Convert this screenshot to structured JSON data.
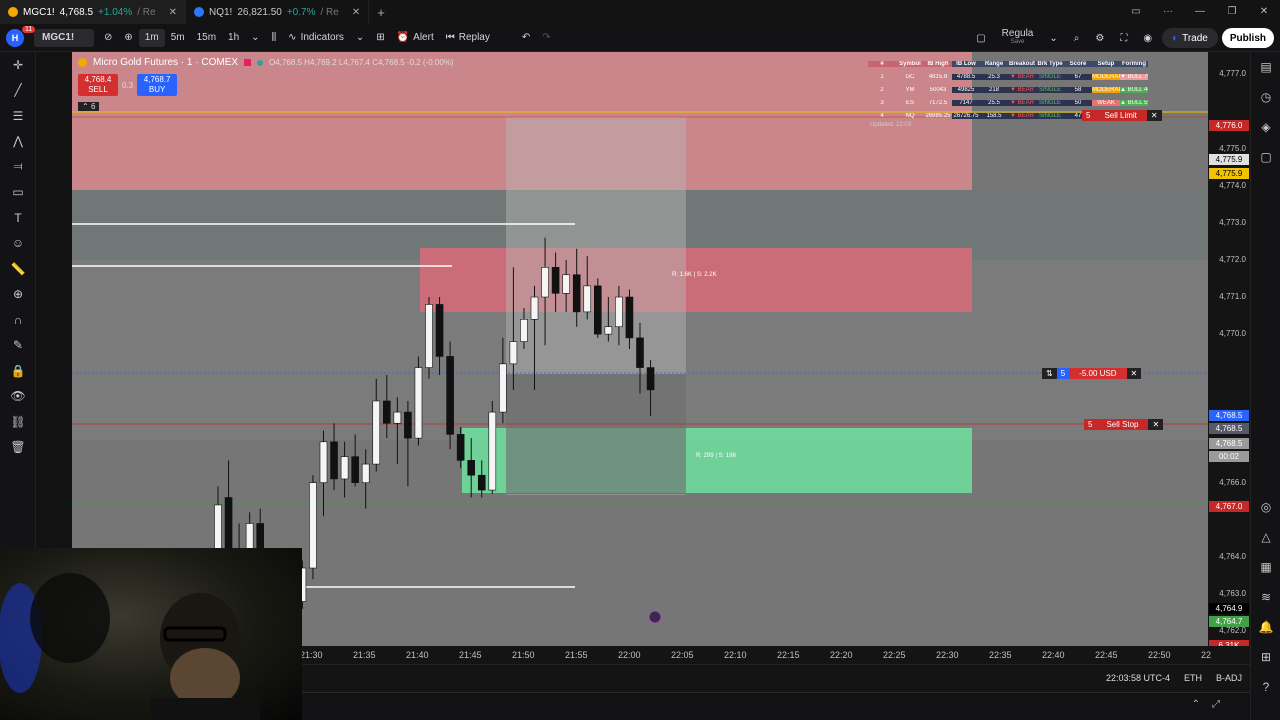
{
  "tabs": [
    {
      "symbol": "MGC1!",
      "price": "4,768.5",
      "change": "+1.04%",
      "suffix": "/ Re"
    },
    {
      "symbol": "NQ1!",
      "price": "26,821.50",
      "change": "+0.7%",
      "suffix": "/ Re"
    }
  ],
  "toolbar": {
    "badge": "11",
    "symbol": "MGC1!",
    "intervals": [
      "1m",
      "5m",
      "15m",
      "1h"
    ],
    "indicators_label": "Indicators",
    "alert_label": "Alert",
    "replay_label": "Replay",
    "layout_name": "Regula",
    "layout_sub": "Save",
    "trade_label": "Trade",
    "publish_label": "Publish"
  },
  "legend": {
    "title": "Micro Gold Futures · 1 · COMEX",
    "ohlc": "O4,768.5  H4,769.2  L4,767.4  C4,768.5  -0.2 (-0.00%)",
    "sell_price": "4,768.4",
    "sell_label": "SELL",
    "spread": "0.3",
    "buy_price": "4,768.7",
    "buy_label": "BUY",
    "indicator_count": "6"
  },
  "table": {
    "headers": [
      "#",
      "Symbol",
      "IB High",
      "IB Low",
      "Range",
      "Breakout",
      "Brk Type",
      "Score",
      "Setup",
      "Forming"
    ],
    "rows": [
      [
        "1",
        "GC",
        "4815.8",
        "4788.5",
        "25.3",
        "▼ BEAR",
        "SINGLE",
        "67",
        "MODERATE",
        "▼ BULL 79%"
      ],
      [
        "2",
        "YM",
        "50043",
        "49825",
        "218",
        "▼ BEAR",
        "SINGLE",
        "58",
        "MODERATE",
        "▲ BULL 46%"
      ],
      [
        "3",
        "ES",
        "7172.5",
        "7147",
        "25.5",
        "▼ BEAR",
        "SINGLE",
        "50",
        "WEAK",
        "▲ BULL 59%"
      ],
      [
        "4",
        "NQ",
        "26885.25",
        "26726.75",
        "158.5",
        "▼ BEAR",
        "SINGLE",
        "47",
        "WEAK",
        "▲ BULL 53%"
      ]
    ],
    "footer": "Updated: 22:03"
  },
  "orders": [
    {
      "qty": "5",
      "label": "Sell Limit"
    },
    {
      "qty": "5",
      "label": "-5.00 USD"
    },
    {
      "qty": "5",
      "label": "Sell Stop"
    }
  ],
  "position_labels": {
    "upper": "R: 1.6K | S: 2.2K",
    "lower": "R: 299 | S: 196"
  },
  "price_axis": {
    "ticks": [
      "4,777.0",
      "4,775.0",
      "4,774.0",
      "4,773.0",
      "4,772.0",
      "4,771.0",
      "4,770.0",
      "4,766.0",
      "4,764.0",
      "4,763.0",
      "4,762.0"
    ],
    "tags": [
      {
        "text": "4,776.0",
        "color": "#c62828"
      },
      {
        "text": "4,775.9",
        "color": "#e0e0e0"
      },
      {
        "text": "4,775.9",
        "color": "#f2c300"
      },
      {
        "text": "4,768.5",
        "color": "#2962ff"
      },
      {
        "text": "4,768.5",
        "color": "#555a66"
      },
      {
        "text": "4,768.5",
        "color": "#9a9a9a"
      },
      {
        "text": "00:02",
        "color": "#9a9a9a"
      },
      {
        "text": "4,767.0",
        "color": "#c62828"
      },
      {
        "text": "4,764.9",
        "color": "#000000"
      },
      {
        "text": "4,764.7",
        "color": "#43a047"
      },
      {
        "text": "6.31K",
        "color": "#c62828"
      }
    ]
  },
  "time_axis": [
    "21:30",
    "21:35",
    "21:40",
    "21:45",
    "21:50",
    "21:55",
    "22:00",
    "22:05",
    "22:10",
    "22:15",
    "22:20",
    "22:25",
    "22:30",
    "22:35",
    "22:40",
    "22:45",
    "22:50",
    "22"
  ],
  "status": {
    "time": "22:03:58 UTC-4",
    "session": "ETH",
    "adj": "B-ADJ"
  },
  "candles": [
    {
      "o": 4764.2,
      "h": 4765.9,
      "l": 4763.0,
      "c": 4765.4
    },
    {
      "o": 4765.6,
      "h": 4766.6,
      "l": 4763.4,
      "c": 4764.0
    },
    {
      "o": 4764.1,
      "h": 4764.9,
      "l": 4762.9,
      "c": 4763.4
    },
    {
      "o": 4763.4,
      "h": 4765.2,
      "l": 4762.5,
      "c": 4764.9
    },
    {
      "o": 4764.9,
      "h": 4765.3,
      "l": 4762.6,
      "c": 4763.1
    },
    {
      "o": 4763.1,
      "h": 4763.5,
      "l": 4762.2,
      "c": 4762.9
    },
    {
      "o": 4763.0,
      "h": 4763.6,
      "l": 4762.4,
      "c": 4762.7
    },
    {
      "o": 4762.7,
      "h": 4763.2,
      "l": 4762.1,
      "c": 4762.8
    },
    {
      "o": 4762.8,
      "h": 4763.9,
      "l": 4762.6,
      "c": 4763.7
    },
    {
      "o": 4763.7,
      "h": 4766.2,
      "l": 4763.4,
      "c": 4766.0
    },
    {
      "o": 4766.0,
      "h": 4767.4,
      "l": 4765.1,
      "c": 4767.1
    },
    {
      "o": 4767.1,
      "h": 4767.6,
      "l": 4765.8,
      "c": 4766.1
    },
    {
      "o": 4766.1,
      "h": 4767.1,
      "l": 4765.6,
      "c": 4766.7
    },
    {
      "o": 4766.7,
      "h": 4767.3,
      "l": 4765.9,
      "c": 4766.0
    },
    {
      "o": 4766.0,
      "h": 4766.9,
      "l": 4765.3,
      "c": 4766.5
    },
    {
      "o": 4766.5,
      "h": 4768.8,
      "l": 4766.3,
      "c": 4768.2
    },
    {
      "o": 4768.2,
      "h": 4768.9,
      "l": 4767.2,
      "c": 4767.6
    },
    {
      "o": 4767.6,
      "h": 4768.3,
      "l": 4766.5,
      "c": 4767.9
    },
    {
      "o": 4767.9,
      "h": 4768.2,
      "l": 4765.9,
      "c": 4767.2
    },
    {
      "o": 4767.2,
      "h": 4769.4,
      "l": 4767.0,
      "c": 4769.1
    },
    {
      "o": 4769.1,
      "h": 4771.0,
      "l": 4768.8,
      "c": 4770.8
    },
    {
      "o": 4770.8,
      "h": 4771.0,
      "l": 4768.9,
      "c": 4769.4
    },
    {
      "o": 4769.4,
      "h": 4769.8,
      "l": 4766.9,
      "c": 4767.3
    },
    {
      "o": 4767.3,
      "h": 4767.5,
      "l": 4766.4,
      "c": 4766.6
    },
    {
      "o": 4766.6,
      "h": 4767.2,
      "l": 4765.6,
      "c": 4766.2
    },
    {
      "o": 4766.2,
      "h": 4766.6,
      "l": 4765.6,
      "c": 4765.8
    },
    {
      "o": 4765.8,
      "h": 4768.2,
      "l": 4765.7,
      "c": 4767.9
    },
    {
      "o": 4767.9,
      "h": 4769.9,
      "l": 4767.6,
      "c": 4769.2
    },
    {
      "o": 4769.2,
      "h": 4771.8,
      "l": 4768.5,
      "c": 4769.8
    },
    {
      "o": 4769.8,
      "h": 4770.7,
      "l": 4769.6,
      "c": 4770.4
    },
    {
      "o": 4770.4,
      "h": 4771.3,
      "l": 4768.5,
      "c": 4771.0
    },
    {
      "o": 4771.0,
      "h": 4772.6,
      "l": 4769.7,
      "c": 4771.8
    },
    {
      "o": 4771.8,
      "h": 4772.2,
      "l": 4770.6,
      "c": 4771.1
    },
    {
      "o": 4771.1,
      "h": 4772.0,
      "l": 4770.6,
      "c": 4771.6
    },
    {
      "o": 4771.6,
      "h": 4772.3,
      "l": 4770.2,
      "c": 4770.6
    },
    {
      "o": 4770.6,
      "h": 4772.1,
      "l": 4770.4,
      "c": 4771.3
    },
    {
      "o": 4771.3,
      "h": 4771.5,
      "l": 4769.9,
      "c": 4770.0
    },
    {
      "o": 4770.0,
      "h": 4771.0,
      "l": 4769.8,
      "c": 4770.2
    },
    {
      "o": 4770.2,
      "h": 4771.3,
      "l": 4769.7,
      "c": 4771.0
    },
    {
      "o": 4771.0,
      "h": 4771.2,
      "l": 4769.6,
      "c": 4769.9
    },
    {
      "o": 4769.9,
      "h": 4770.3,
      "l": 4768.4,
      "c": 4769.1
    },
    {
      "o": 4769.1,
      "h": 4769.3,
      "l": 4767.8,
      "c": 4768.5
    }
  ]
}
